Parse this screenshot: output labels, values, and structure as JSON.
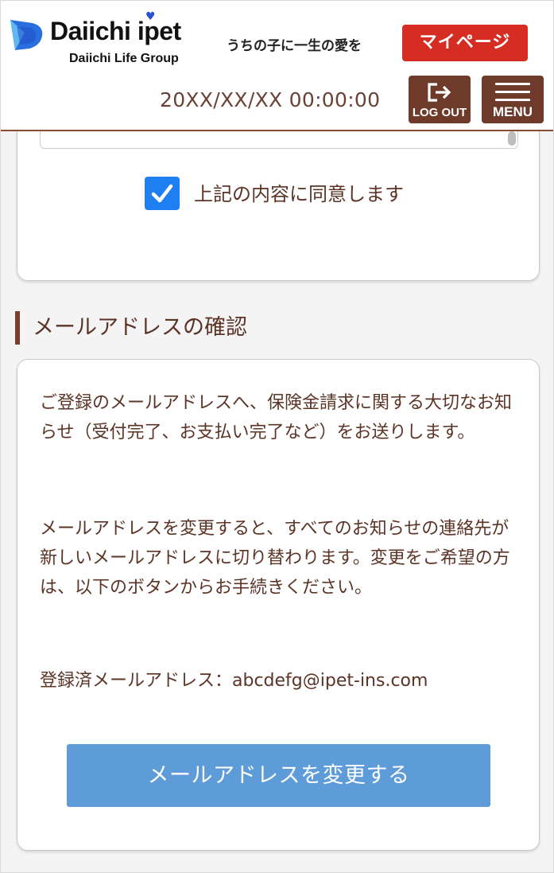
{
  "header": {
    "brand_name": "Daiichi ipet",
    "brand_group": "Daiichi Life Group",
    "tagline": "うちの子に一生の愛を",
    "mypage_label": "マイページ",
    "datetime": "20XX/XX/XX 00:00:00",
    "logout_label": "LOG OUT",
    "menu_label": "MENU"
  },
  "agreement": {
    "checkbox_checked": true,
    "label": "上記の内容に同意します"
  },
  "email_section": {
    "title": "メールアドレスの確認",
    "paragraph1": "ご登録のメールアドレスへ、保険金請求に関する大切なお知らせ（受付完了、お支払い完了など）をお送りします。",
    "paragraph2": "メールアドレスを変更すると、すべてのお知らせの連絡先が新しいメールアドレスに切り替わります。変更をご希望の方は、以下のボタンからお手続きください。",
    "registered_label": "登録済メールアドレス：",
    "registered_email": "abcdefg@ipet-ins.com",
    "change_button_label": "メールアドレスを変更する"
  },
  "colors": {
    "brand_brown": "#6e3b2b",
    "text_brown": "#5b3426",
    "mypage_red": "#d52d22",
    "checkbox_blue": "#1f7ff0",
    "button_blue": "#5d9cd9"
  },
  "icons": {
    "logo": "daiichi-ipet-logo-icon",
    "logout": "logout-arrow-icon",
    "menu": "hamburger-menu-icon",
    "checkbox": "checkmark-icon"
  }
}
